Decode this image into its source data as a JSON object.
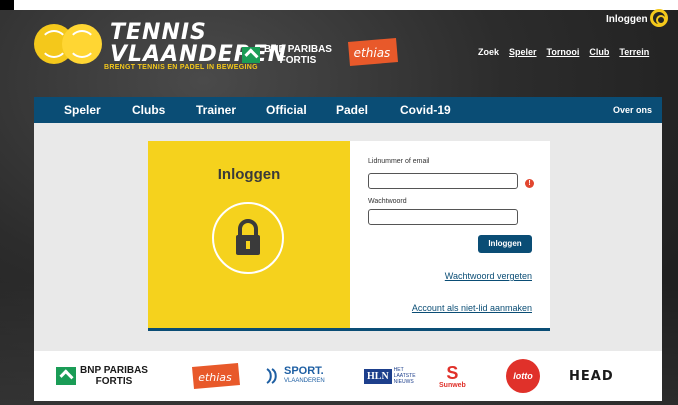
{
  "header": {
    "logo": {
      "line1": "TENNIS",
      "line2": "VLAANDEREN",
      "tagline": "BRENGT TENNIS EN PADEL IN BEWEGING"
    },
    "sponsor_top": {
      "name_line1": "BNP PARIBAS",
      "name_line2": "FORTIS",
      "ethias": "ethias"
    },
    "login_link": "Inloggen",
    "links": [
      {
        "label": "Zoek",
        "underlined": false
      },
      {
        "label": "Speler",
        "underlined": true
      },
      {
        "label": "Tornooi",
        "underlined": true
      },
      {
        "label": "Club",
        "underlined": true
      },
      {
        "label": "Terrein",
        "underlined": true
      }
    ]
  },
  "nav": {
    "items": [
      "Speler",
      "Clubs",
      "Trainer",
      "Official",
      "Padel",
      "Covid-19"
    ],
    "right": "Over ons"
  },
  "login": {
    "title": "Inloggen",
    "member_label": "Lidnummer of email",
    "member_value": "",
    "password_label": "Wachtwoord",
    "password_value": "",
    "submit": "Inloggen",
    "forgot": "Wachtwoord vergeten",
    "create": "Account als niet-lid aanmaken",
    "warning_glyph": "!"
  },
  "sponsors": {
    "bnp_line1": "BNP PARIBAS",
    "bnp_line2": "FORTIS",
    "ethias": "ethias",
    "sport_line1": "SPORT.",
    "sport_line2": "VLAANDEREN",
    "hln": "HLN",
    "hln_sub1": "HET",
    "hln_sub2": "LAATSTE",
    "hln_sub3": "NIEUWS",
    "sunweb_mark": "S",
    "sunweb": "Sunweb",
    "lotto": "lotto",
    "head": "HEAD"
  },
  "colors": {
    "nav_blue": "#0a4d75",
    "yellow": "#f5d21d",
    "warning": "#e2462f",
    "green": "#1a9c56"
  }
}
